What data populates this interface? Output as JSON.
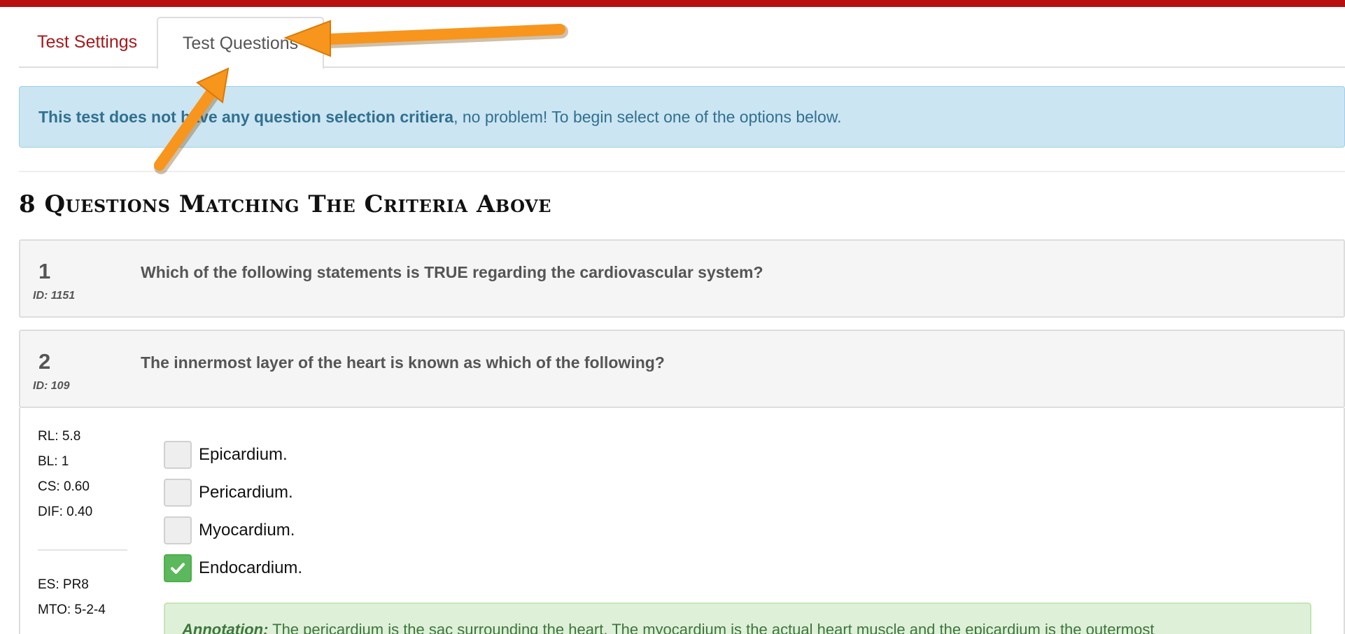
{
  "tabs": [
    {
      "label": "Test Settings"
    },
    {
      "label": "Test Questions"
    }
  ],
  "alert": {
    "bold": "This test does not have any question selection critiera",
    "rest": ", no problem! To begin select one of the options below."
  },
  "section_title": "8 Questions Matching The Criteria Above",
  "questions": [
    {
      "number": "1",
      "id": "ID: 1151",
      "text": "Which of the following statements is TRUE regarding the cardiovascular system?"
    },
    {
      "number": "2",
      "id": "ID: 109",
      "text": "The innermost layer of the heart is known as which of the following?"
    }
  ],
  "details": {
    "stats": [
      "RL: 5.8",
      "BL: 1",
      "CS: 0.60",
      "DIF: 0.40"
    ],
    "stats2": [
      "ES: PR8",
      "MTO: 5-2-4"
    ],
    "options": [
      {
        "label": "Epicardium.",
        "checked": false
      },
      {
        "label": "Pericardium.",
        "checked": false
      },
      {
        "label": "Myocardium.",
        "checked": false
      },
      {
        "label": "Endocardium.",
        "checked": true
      }
    ],
    "annotation_label": "Annotation:",
    "annotation_text": "The pericardium is the sac surrounding the heart. The myocardium is the actual heart muscle and the epicardium is the outermost"
  },
  "colors": {
    "brand": "#b80f10",
    "tab_link": "#a5191c",
    "alert_bg": "#cbe5f2",
    "success": "#5cb85c",
    "arrow": "#f7951d"
  }
}
